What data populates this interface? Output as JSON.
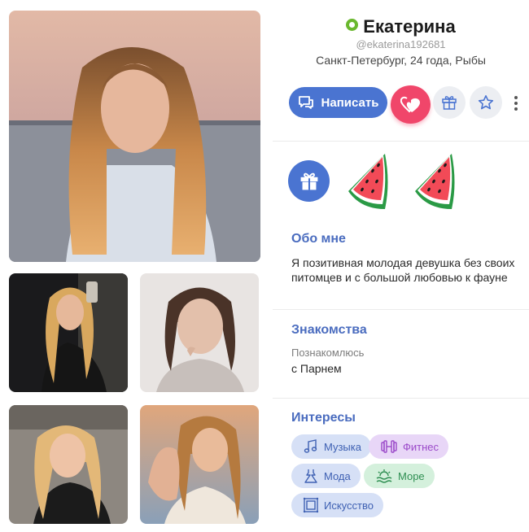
{
  "profile": {
    "name": "Екатерина",
    "username": "@ekaterina192681",
    "location": "Санкт-Петербург, 24 года, Рыбы",
    "online": true
  },
  "actions": {
    "write_label": "Написать",
    "like_icon": "heart-icon",
    "gift_icon": "gift-icon",
    "favorite_icon": "star-icon",
    "more_icon": "more-vertical-icon"
  },
  "gifts": {
    "send_icon": "gift-icon",
    "received": [
      "watermelon-sticker",
      "watermelon-sticker"
    ]
  },
  "about": {
    "title": "Обо мне",
    "text": "Я позитивная молодая девушка без своих питомцев и с большой любовью к фауне"
  },
  "dating": {
    "title": "Знакомства",
    "label": "Познакомлюсь",
    "value": "с Парнем"
  },
  "interests": {
    "title": "Интересы",
    "items": [
      {
        "label": "Музыка",
        "icon": "headphones-icon",
        "color": "blue"
      },
      {
        "label": "Фитнес",
        "icon": "dumbbell-icon",
        "color": "purple"
      },
      {
        "label": "Мода",
        "icon": "dress-icon",
        "color": "blue"
      },
      {
        "label": "Море",
        "icon": "sea-icon",
        "color": "green"
      },
      {
        "label": "Искусство",
        "icon": "frame-icon",
        "color": "blue"
      }
    ]
  },
  "colors": {
    "accent": "#4a74d1",
    "like": "#f0466a",
    "online": "#6ab82e",
    "section_title": "#4a6cbf"
  }
}
